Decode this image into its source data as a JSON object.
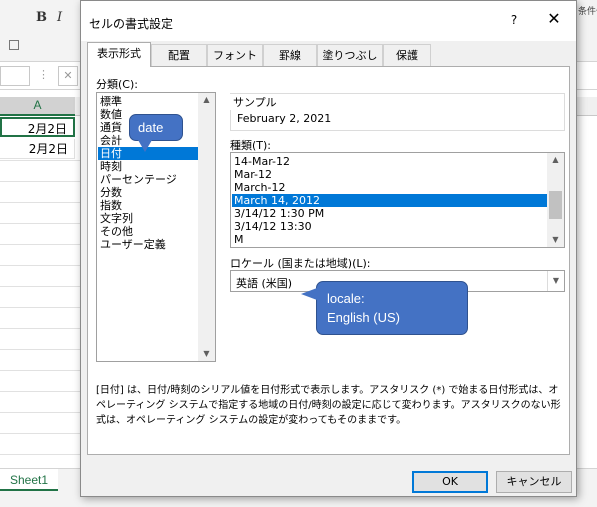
{
  "excel": {
    "bold_label": "B",
    "italic_label": "I",
    "right_text": "条件付き",
    "x_label": "✕",
    "dots": "⋮",
    "col_a": "A",
    "cells": [
      "2月2日",
      "2月2日"
    ],
    "sheet_tab": "Sheet1"
  },
  "dialog": {
    "title": "セルの書式設定",
    "help": "?",
    "close": "✕",
    "tabs": [
      "表示形式",
      "配置",
      "フォント",
      "罫線",
      "塗りつぶし",
      "保護"
    ],
    "category_label": "分類(C):",
    "categories": [
      "標準",
      "数値",
      "通貨",
      "会計",
      "日付",
      "時刻",
      "パーセンテージ",
      "分数",
      "指数",
      "文字列",
      "その他",
      "ユーザー定義"
    ],
    "selected_category": "日付",
    "sample_label": "サンプル",
    "sample_value": "February 2, 2021",
    "type_label": "種類(T):",
    "types": [
      "14-Mar-12",
      "Mar-12",
      "March-12",
      "March 14, 2012",
      "3/14/12 1:30 PM",
      "3/14/12 13:30",
      "M"
    ],
    "selected_type": "March 14, 2012",
    "locale_label": "ロケール (国または地域)(L):",
    "locale_value": "英語 (米国)",
    "description": "[日付] は、日付/時刻のシリアル値を日付形式で表示します。アスタリスク (*) で始まる日付形式は、オペレーティング システムで指定する地域の日付/時刻の設定に応じて変わります。アスタリスクのない形式は、オペレーティング システムの設定が変わってもそのままです。",
    "ok": "OK",
    "cancel": "キャンセル"
  },
  "callouts": {
    "date": "date",
    "locale_line1": "locale:",
    "locale_line2": "English (US)"
  },
  "colors": {
    "selection": "#0078d7",
    "callout_fill": "#4472c4",
    "excel_green": "#217346"
  }
}
